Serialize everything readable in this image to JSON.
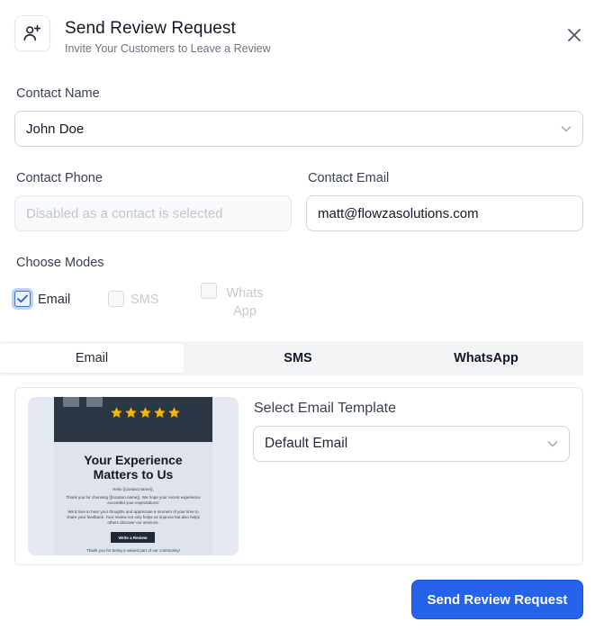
{
  "header": {
    "title": "Send Review Request",
    "subtitle": "Invite Your Customers to Leave a Review",
    "icon": "user-plus-icon",
    "close_icon": "close-icon"
  },
  "contact_name": {
    "label": "Contact Name",
    "value": "John Doe"
  },
  "contact_phone": {
    "label": "Contact Phone",
    "placeholder": "Disabled as a contact is selected"
  },
  "contact_email": {
    "label": "Contact Email",
    "value": "matt@flowzasolutions.com"
  },
  "modes": {
    "label": "Choose Modes",
    "options": [
      {
        "label": "Email",
        "checked": true,
        "disabled": false
      },
      {
        "label": "SMS",
        "checked": false,
        "disabled": true
      },
      {
        "label": "Whats App",
        "line1": "Whats",
        "line2": "App",
        "checked": false,
        "disabled": true
      }
    ]
  },
  "tabs": [
    {
      "label": "Email",
      "active": true
    },
    {
      "label": "SMS",
      "active": false
    },
    {
      "label": "WhatsApp",
      "active": false
    }
  ],
  "template": {
    "label": "Select Email Template",
    "selected": "Default Email",
    "preview": {
      "heading_line1": "Your Experience",
      "heading_line2": "Matters to Us",
      "greeting": "Hello {{contact.name}},",
      "para1": "Thank you for choosing {{location.name}}. We hope your recent experience exceeded your expectations!",
      "para2": "We'd love to hear your thoughts and appreciate a moment of your time to share your feedback. Your review not only helps us improve but also helps others discover our services.",
      "button": "Write a Review",
      "footer": "Thank you for being a valued part of our community!",
      "star_count": 5
    }
  },
  "send_button": "Send Review Request",
  "colors": {
    "primary": "#2563eb",
    "star": "#f5b800",
    "checkbox_accent": "#3b6fd8"
  }
}
